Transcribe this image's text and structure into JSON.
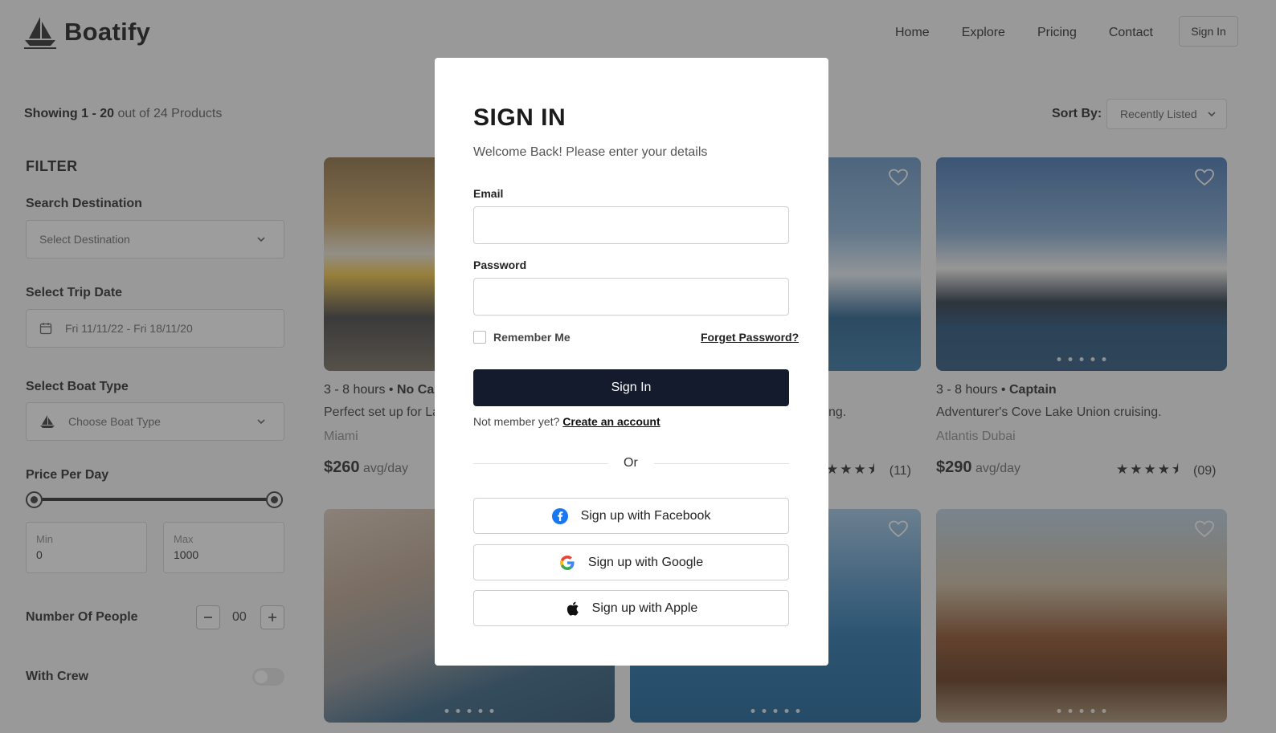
{
  "brand": {
    "name": "Boatify",
    "logo_icon": "sailboat-icon"
  },
  "nav": {
    "links": [
      "Home",
      "Explore",
      "Pricing",
      "Contact"
    ],
    "signin_label": "Sign In"
  },
  "listing": {
    "showing_range": "Showing 1 - 20",
    "showing_rest": " out of 24 Products",
    "sort_label": "Sort By:",
    "sort_value": "Recently Listed"
  },
  "filter": {
    "title": "FILTER",
    "destination_label": "Search Destination",
    "destination_placeholder": "Select Destination",
    "date_label": "Select Trip Date",
    "date_value": "Fri 11/11/22 - Fri 18/11/20",
    "boat_type_label": "Select Boat Type",
    "boat_type_placeholder": "Choose Boat Type",
    "price_label": "Price Per Day",
    "min_label": "Min",
    "min_value": "0",
    "max_label": "Max",
    "max_value": "1000",
    "people_label": "Number Of People",
    "people_value": "00",
    "crew_label": "With Crew",
    "crew_enabled": false
  },
  "cards": [
    {
      "duration": "3 - 8 hours",
      "crew": "No Ca",
      "title": "Perfect set up for La",
      "location": "Miami",
      "price": "$260",
      "price_unit": " avg/day"
    },
    {
      "title_tail": "ng.",
      "rating_count": "(11)"
    },
    {
      "duration": "3 - 8 hours",
      "crew": "Captain",
      "title": "Adventurer's Cove Lake Union cruising.",
      "location": "Atlantis Dubai",
      "price": "$290",
      "price_unit": " avg/day",
      "rating_count": "(09)"
    }
  ],
  "colors": {
    "primary": "#141b2d",
    "overlay": "rgba(60,60,60,0.5)"
  },
  "modal": {
    "title": "SIGN IN",
    "subtitle": "Welcome Back! Please enter your details",
    "email_label": "Email",
    "email_value": "",
    "password_label": "Password",
    "password_value": "",
    "remember_label": "Remember Me",
    "forgot_label": "Forget Password?",
    "submit_label": "Sign In",
    "not_member_text": "Not member yet? ",
    "create_account_label": "Create an account",
    "or_text": "Or",
    "facebook_label": "Sign up with Facebook",
    "google_label": "Sign up with Google",
    "apple_label": "Sign up with Apple"
  }
}
